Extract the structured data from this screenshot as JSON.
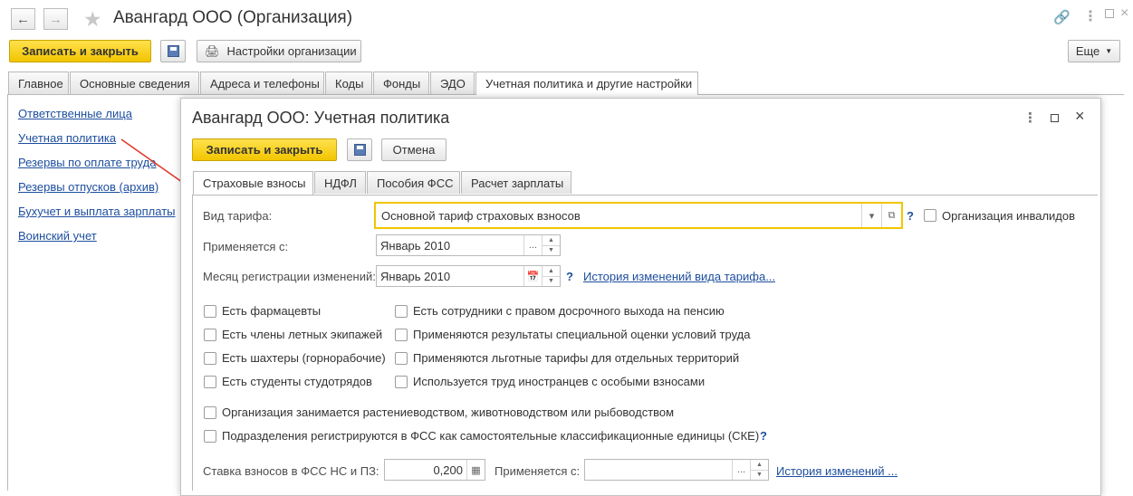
{
  "window": {
    "title": "Авангард ООО (Организация)",
    "save_close": "Записать и закрыть",
    "settings_btn": "Настройки организации",
    "more": "Еще"
  },
  "tabs": [
    "Главное",
    "Основные сведения",
    "Адреса и телефоны",
    "Коды",
    "Фонды",
    "ЭДО",
    "Учетная политика и другие настройки"
  ],
  "sidebar": [
    "Ответственные лица",
    "Учетная политика",
    "Резервы по оплате труда",
    "Резервы отпусков (архив)",
    "Бухучет и выплата зарплаты",
    "Воинский учет"
  ],
  "dialog": {
    "title": "Авангард ООО: Учетная политика",
    "save_close": "Записать и закрыть",
    "cancel": "Отмена",
    "tabs": [
      "Страховые взносы",
      "НДФЛ",
      "Пособия ФСС",
      "Расчет зарплаты"
    ],
    "tariff_label": "Вид тарифа:",
    "tariff_value": "Основной тариф страховых взносов",
    "invalid_org": "Организация инвалидов",
    "applies_label": "Применяется с:",
    "applies_value": "Январь 2010",
    "month_label": "Месяц регистрации изменений:",
    "month_value": "Январь 2010",
    "history_link": "История изменений вида тарифа...",
    "checks_left": [
      "Есть фармацевты",
      "Есть члены летных экипажей",
      "Есть шахтеры (горнорабочие)",
      "Есть студенты студотрядов"
    ],
    "checks_right": [
      "Есть сотрудники с правом досрочного выхода на пенсию",
      "Применяются результаты специальной оценки условий труда",
      "Применяются льготные тарифы для отдельных территорий",
      "Используется труд иностранцев с особыми взносами"
    ],
    "check_agri": "Организация занимается растениеводством, животноводством или рыбоводством",
    "check_fss": "Подразделения регистрируются в ФСС как самостоятельные классификационные единицы (СКЕ)",
    "rate_label": "Ставка взносов в ФСС НС и ПЗ:",
    "rate_value": "0,200",
    "rate_applies_label": "Применяется с:",
    "rate_history": "История изменений ..."
  },
  "colors": {
    "accent_yellow": "#f2c500",
    "link": "#1d4e9e",
    "arrow": "#e03a2a"
  }
}
